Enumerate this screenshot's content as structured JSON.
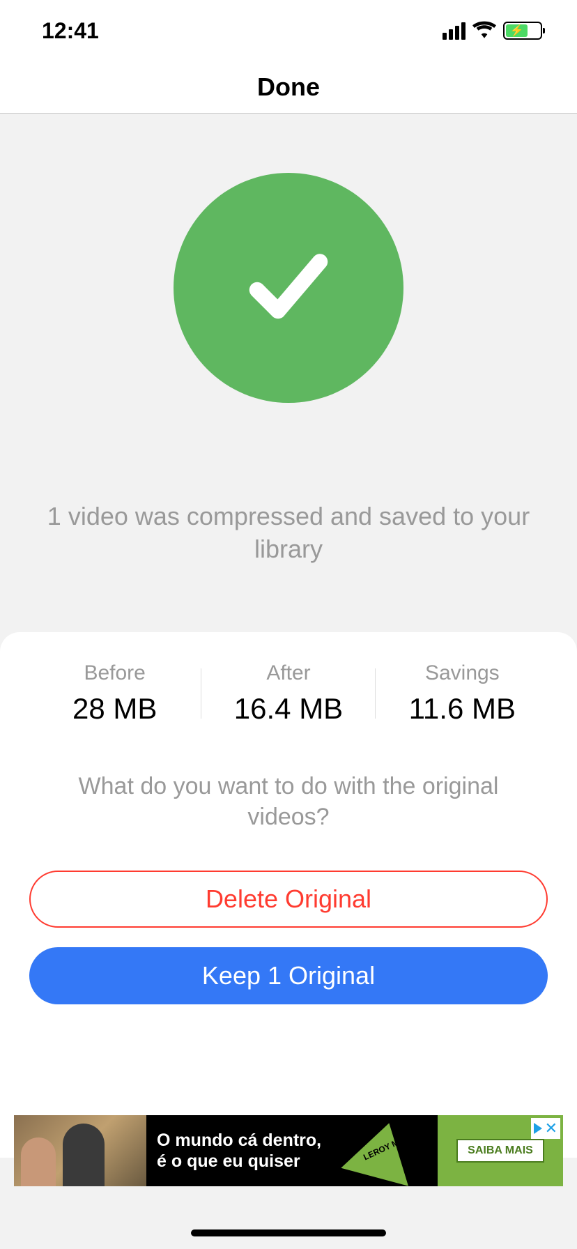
{
  "statusBar": {
    "time": "12:41"
  },
  "navBar": {
    "title": "Done"
  },
  "successMessage": "1 video was compressed and saved to your library",
  "stats": {
    "before": {
      "label": "Before",
      "value": "28 MB"
    },
    "after": {
      "label": "After",
      "value": "16.4 MB"
    },
    "savings": {
      "label": "Savings",
      "value": "11.6 MB"
    }
  },
  "question": "What do you want to do with the original videos?",
  "buttons": {
    "delete": "Delete Original",
    "keep": "Keep 1 Original"
  },
  "ad": {
    "text_line1": "O mundo cá dentro,",
    "text_line2": "é o que eu quiser",
    "logo": "LEROY MERLIN",
    "cta": "SAIBA MAIS"
  }
}
